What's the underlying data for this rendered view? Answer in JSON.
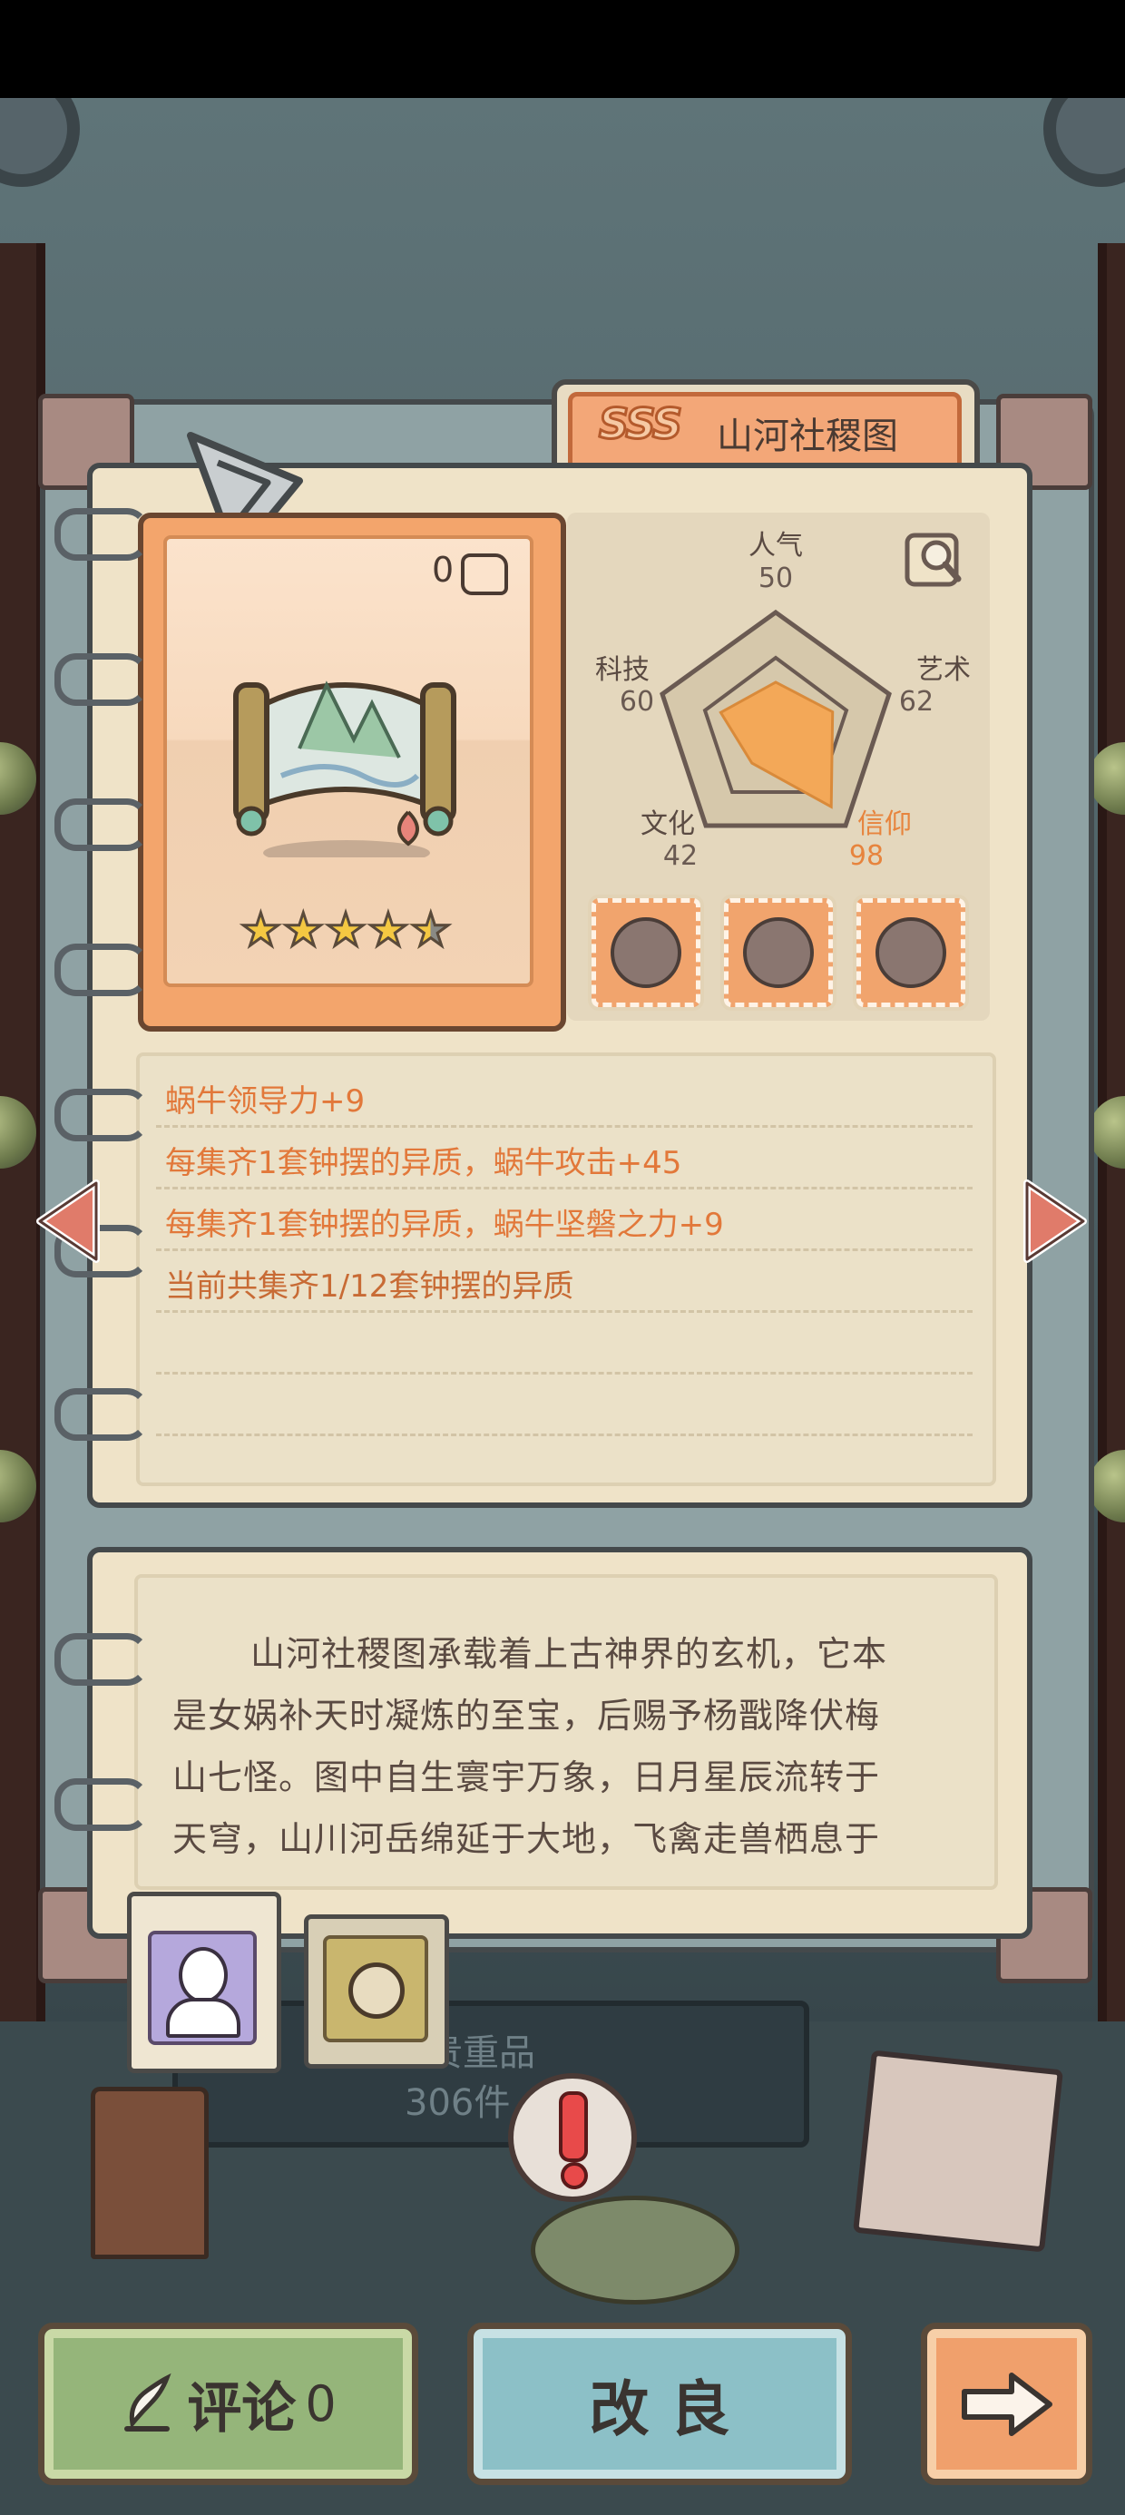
{
  "item": {
    "rank": "SSS",
    "title": "山河社稷图",
    "owned_count": "0",
    "stars_filled": 4.5,
    "stars_total": 5
  },
  "stats": [
    {
      "label": "人气",
      "value": "50",
      "highlight": false
    },
    {
      "label": "艺术",
      "value": "62",
      "highlight": false
    },
    {
      "label": "信仰",
      "value": "98",
      "highlight": true
    },
    {
      "label": "文化",
      "value": "42",
      "highlight": false
    },
    {
      "label": "科技",
      "value": "60",
      "highlight": false
    }
  ],
  "effects": [
    "蜗牛领导力+9",
    "每集齐1套钟摆的异质，蜗牛攻击+45",
    "每集齐1套钟摆的异质，蜗牛坚磐之力+9",
    "当前共集齐1/12套钟摆的异质"
  ],
  "description_lines": [
    "山河社稷图承载着上古神界的玄机，它本",
    "是女娲补天时凝炼的至宝，后赐予杨戬降伏梅",
    "山七怪。图中自生寰宇万象，日月星辰流转于",
    "天穹，山川河岳绵延于大地，飞禽走兽栖息于"
  ],
  "background": {
    "gift_label": "珍贵重品",
    "gift_count": "306件"
  },
  "buttons": {
    "comment_label": "评论",
    "comment_count": "0",
    "improve_label": "改 良"
  },
  "icons": {
    "zoom": "magnifier-icon",
    "prev": "left-arrow-icon",
    "next": "right-arrow-icon",
    "next_button": "arrow-right-icon",
    "comment": "quill-icon",
    "portrait_tab": "bust-icon",
    "sun_tab": "sun-face-icon"
  },
  "colors": {
    "effect_text": "#e2783a",
    "highlight_stat": "#e7843d",
    "card_orange": "#f3a56c"
  }
}
